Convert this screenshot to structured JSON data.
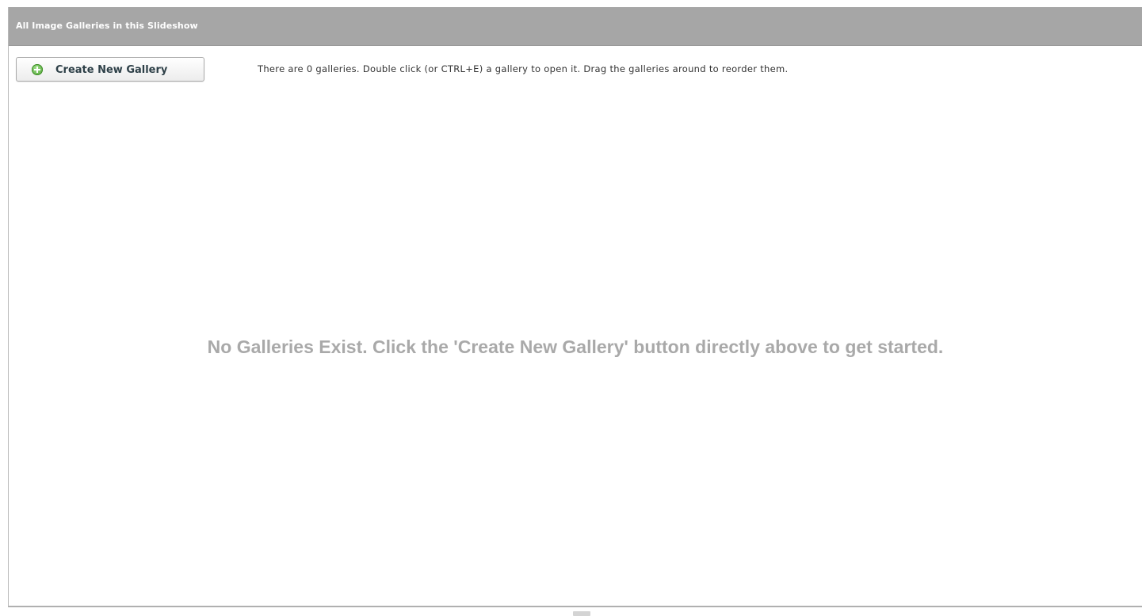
{
  "panel": {
    "title": "All Image Galleries in this Slideshow"
  },
  "toolbar": {
    "create_button_label": "Create New Gallery",
    "create_button_icon": "plus-circle-icon",
    "info_text": "There are 0 galleries.  Double click (or CTRL+E) a gallery to open it.  Drag the galleries around to reorder them."
  },
  "empty_state": {
    "message": "No Galleries Exist.  Click the 'Create New Gallery' button directly above to get started."
  },
  "colors": {
    "header_background": "#a6a6a6",
    "header_text": "#ffffff",
    "button_text": "#2e4048",
    "icon_green": "#4ea232",
    "empty_message_text": "#a9a9a9"
  }
}
